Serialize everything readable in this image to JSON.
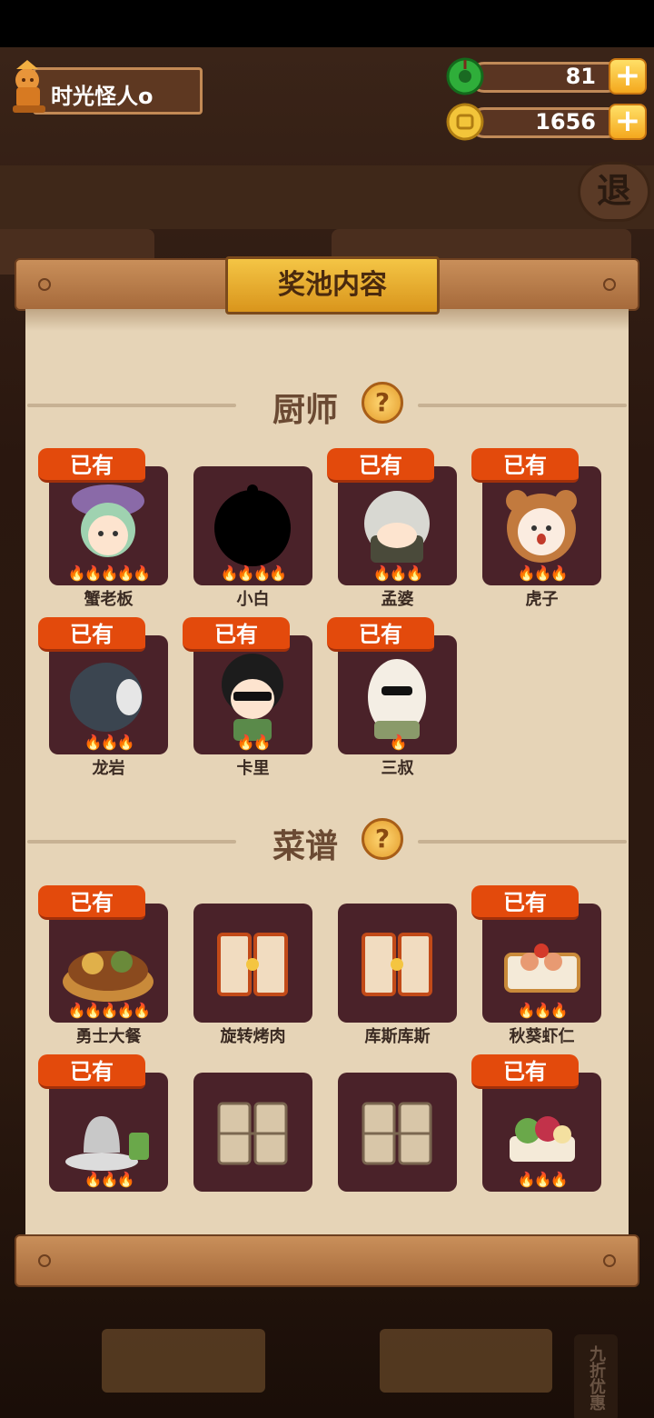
{
  "player": {
    "name": "时光怪人o"
  },
  "currency": {
    "jade": {
      "value": "81",
      "icon": "jade-icon"
    },
    "coins": {
      "value": "1656",
      "icon": "coin-icon"
    },
    "plus": "+"
  },
  "background": {
    "exit": "退",
    "side_tag": "九折优惠"
  },
  "modal": {
    "title": "奖池内容"
  },
  "sections": {
    "chefs": {
      "title": "厨师",
      "help": "?"
    },
    "recipes": {
      "title": "菜谱",
      "help": "?"
    }
  },
  "owned_label": "已有",
  "chefs": [
    {
      "name": "蟹老板",
      "owned": true,
      "stars": 5
    },
    {
      "name": "小白",
      "owned": false,
      "stars": 4
    },
    {
      "name": "孟婆",
      "owned": true,
      "stars": 3
    },
    {
      "name": "虎子",
      "owned": true,
      "stars": 3
    },
    {
      "name": "龙岩",
      "owned": true,
      "stars": 3
    },
    {
      "name": "卡里",
      "owned": true,
      "stars": 2
    },
    {
      "name": "三叔",
      "owned": true,
      "stars": 1
    }
  ],
  "recipes": [
    {
      "name": "勇士大餐",
      "owned": true,
      "stars": 5
    },
    {
      "name": "旋转烤肉",
      "owned": false,
      "stars": 0
    },
    {
      "name": "库斯库斯",
      "owned": false,
      "stars": 0
    },
    {
      "name": "秋葵虾仁",
      "owned": true,
      "stars": 3
    },
    {
      "name": "",
      "owned": true,
      "stars": 3
    },
    {
      "name": "",
      "owned": false,
      "stars": 0
    },
    {
      "name": "",
      "owned": false,
      "stars": 0
    },
    {
      "name": "",
      "owned": true,
      "stars": 3
    }
  ],
  "flame_glyph": "🔥"
}
